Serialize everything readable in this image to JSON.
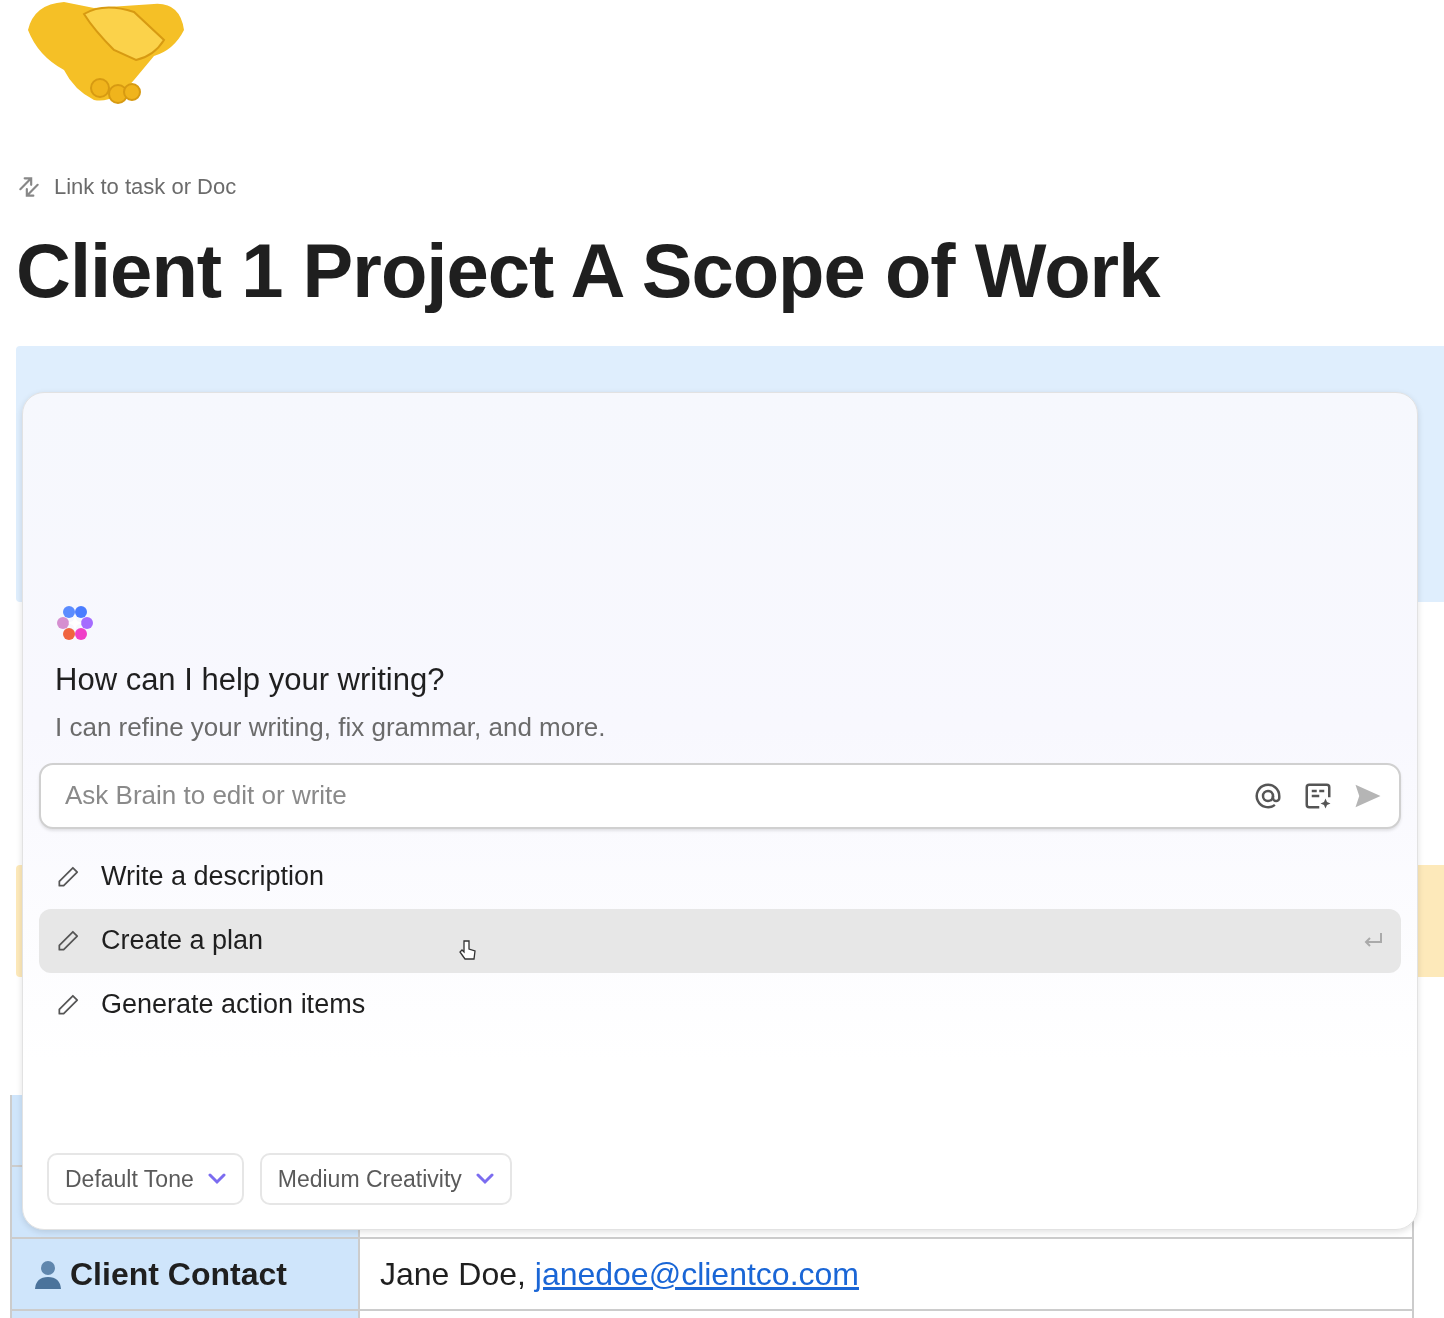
{
  "link_button": "Link to task or Doc",
  "title": "Client 1 Project A Scope of Work",
  "assistant": {
    "heading": "How can I help your writing?",
    "subheading": "I can refine your writing, fix grammar, and more.",
    "input": {
      "placeholder": "Ask Brain to edit or write"
    },
    "suggestions": [
      {
        "label": "Write a description",
        "selected": false
      },
      {
        "label": "Create a plan",
        "selected": true
      },
      {
        "label": "Generate action items",
        "selected": false
      }
    ],
    "dropdowns": [
      "Default Tone",
      "Medium Creativity"
    ]
  },
  "table": {
    "rows": [
      {
        "label": "Client Contact",
        "value": "Jane Doe, ",
        "link": "janedoe@clientco.com"
      }
    ]
  }
}
